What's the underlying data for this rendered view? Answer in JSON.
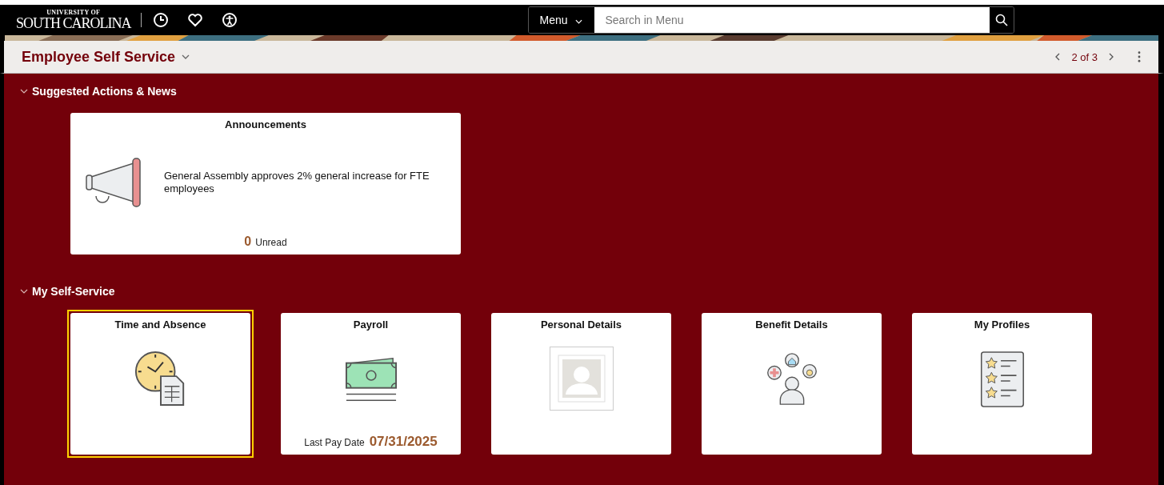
{
  "top_bar": {
    "logo": {
      "small": "UNIVERSITY OF",
      "large": "SOUTH CAROLINA"
    },
    "menu_button": "Menu",
    "search": {
      "placeholder": "Search in Menu"
    }
  },
  "header": {
    "title": "Employee Self Service",
    "pager": "2 of 3"
  },
  "sections": [
    {
      "title": "Suggested Actions & News",
      "expanded": true,
      "tiles": [
        {
          "kind": "announcement",
          "title": "Announcements",
          "text": "General Assembly approves 2% general increase for FTE employees",
          "count": "0",
          "count_label": "Unread",
          "selected": false
        }
      ]
    },
    {
      "title": "My Self-Service",
      "expanded": true,
      "tiles": [
        {
          "kind": "clock",
          "title": "Time and Absence",
          "selected": true
        },
        {
          "kind": "money",
          "title": "Payroll",
          "footer_label": "Last Pay Date",
          "footer_value": "07/31/2025",
          "selected": false
        },
        {
          "title": "Personal Details",
          "selected": false
        },
        {
          "kind": "benefits",
          "title": "Benefit Details",
          "selected": false
        },
        {
          "kind": "profile",
          "title": "My Profiles",
          "selected": false
        }
      ]
    }
  ]
}
